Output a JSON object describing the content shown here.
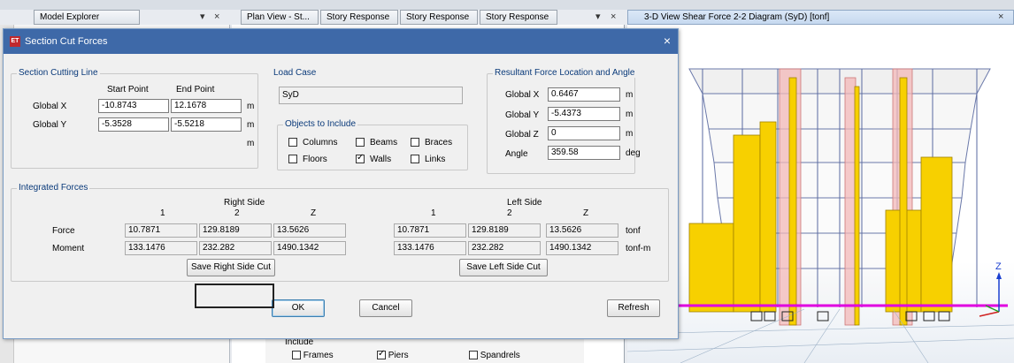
{
  "tabs": {
    "model_explorer": "Model Explorer",
    "plan_view": "Plan View - St...",
    "story_response_1": "Story Response",
    "story_response_2": "Story Response",
    "story_response_3": "Story Response",
    "view3d": "3-D View   Shear Force 2-2 Diagram   (SyD)  [tonf]",
    "pin": "▾",
    "close": "×"
  },
  "dialog": {
    "icon": "ET",
    "title": "Section Cut Forces",
    "close": "×",
    "section_cutting_line": {
      "title": "Section Cutting Line",
      "start_point": "Start Point",
      "end_point": "End Point",
      "global_x_label": "Global X",
      "global_y_label": "Global Y",
      "global_x_start": "-10.8743",
      "global_x_end": "12.1678",
      "global_y_start": "-5.3528",
      "global_y_end": "-5.5218",
      "unit_x": "m",
      "unit_y": "m",
      "unit_extra": "m"
    },
    "load_case": {
      "title": "Load Case",
      "value": "SyD"
    },
    "objects": {
      "title": "Objects to Include",
      "items": [
        {
          "label": "Columns",
          "checked": false
        },
        {
          "label": "Beams",
          "checked": false
        },
        {
          "label": "Braces",
          "checked": false
        },
        {
          "label": "Floors",
          "checked": false
        },
        {
          "label": "Walls",
          "checked": true
        },
        {
          "label": "Links",
          "checked": false
        }
      ]
    },
    "resultant": {
      "title": "Resultant Force Location and Angle",
      "global_x_label": "Global X",
      "global_y_label": "Global Y",
      "global_z_label": "Global Z",
      "angle_label": "Angle",
      "global_x": "0.6467",
      "global_y": "-5.4373",
      "global_z": "0",
      "angle": "359.58",
      "unit_x": "m",
      "unit_y": "m",
      "unit_z": "m",
      "unit_angle": "deg"
    },
    "integrated": {
      "title": "Integrated Forces",
      "right_side": "Right Side",
      "left_side": "Left Side",
      "col1": "1",
      "col2": "2",
      "col3": "Z",
      "force_label": "Force",
      "moment_label": "Moment",
      "right_force": [
        "10.7871",
        "129.8189",
        "13.5626"
      ],
      "right_moment": [
        "133.1476",
        "232.282",
        "1490.1342"
      ],
      "left_force": [
        "10.7871",
        "129.8189",
        "13.5626"
      ],
      "left_moment": [
        "133.1476",
        "232.282",
        "1490.1342"
      ],
      "force_unit": "tonf",
      "moment_unit": "tonf-m",
      "save_right": "Save Right Side Cut",
      "save_left": "Save Left Side Cut"
    },
    "buttons": {
      "ok": "OK",
      "cancel": "Cancel",
      "refresh": "Refresh"
    }
  },
  "lower_panel": {
    "include": "Include",
    "frames": "Frames",
    "piers": "Piers",
    "spandrels": "Spandrels"
  },
  "view3d_axis": "Z",
  "colors": {
    "title_bar": "#3e69a8",
    "accent_label": "#0a3a7a",
    "wall_yellow": "#f7d000",
    "wall_pink": "#f3b8b8",
    "base_line": "#e000e0"
  }
}
